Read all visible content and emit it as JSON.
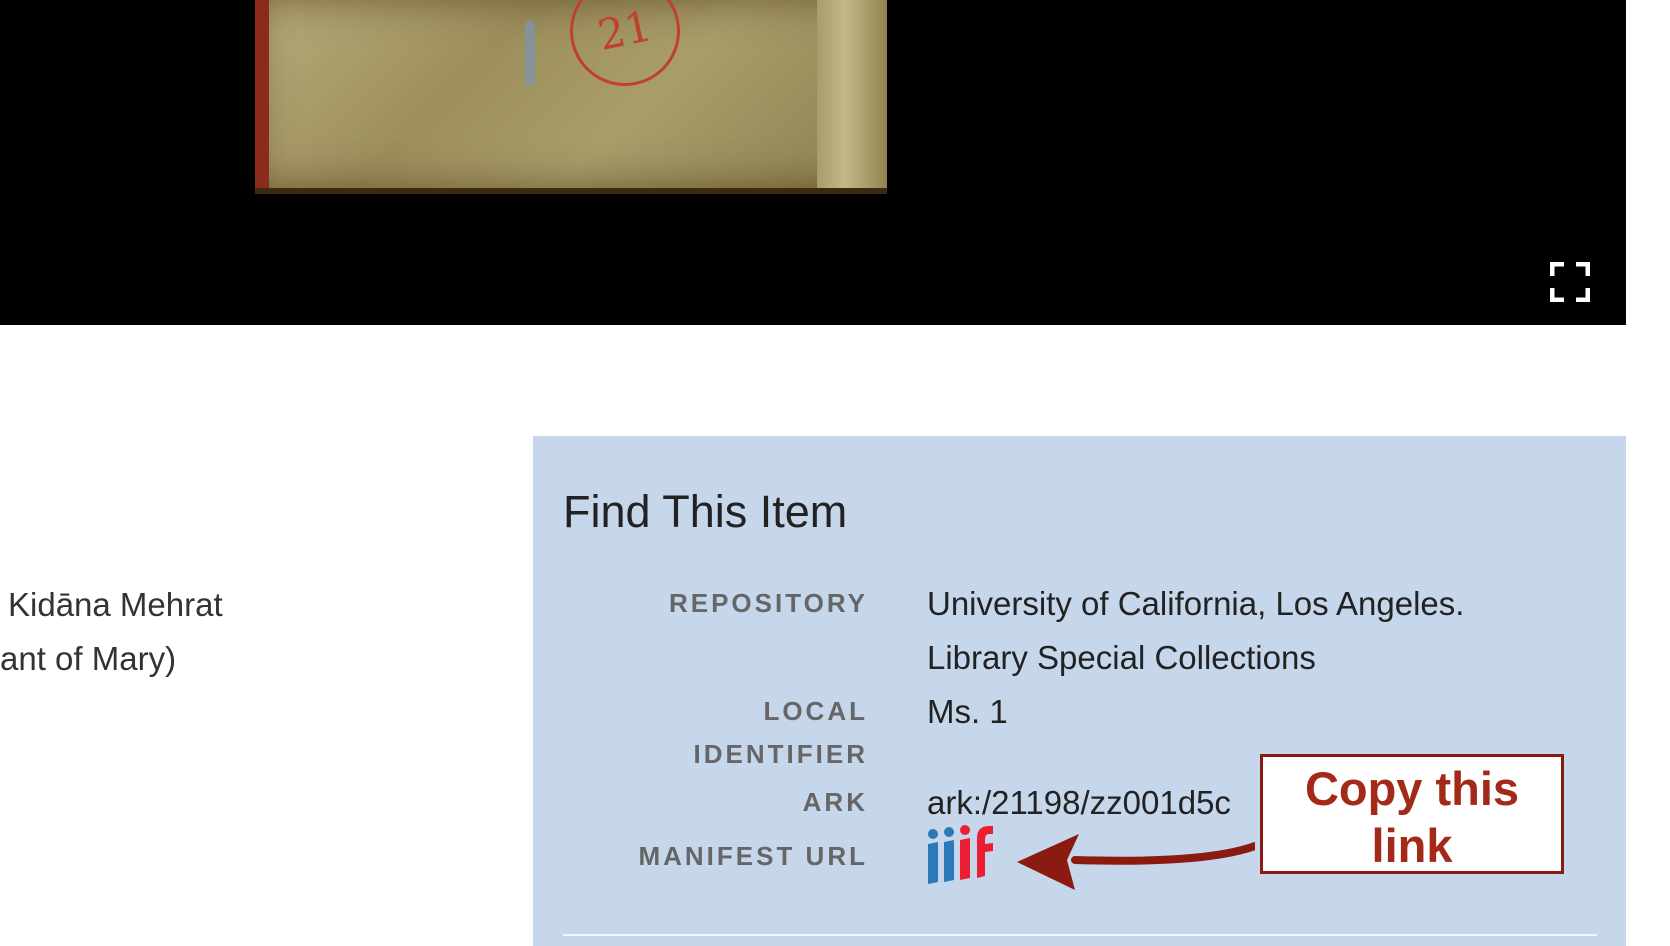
{
  "left_column": {
    "line1": "Kidāna Mehrat",
    "line2": "ant of Mary)"
  },
  "find_item": {
    "title": "Find This Item",
    "fields": {
      "repository": {
        "label": "REPOSITORY",
        "value_line1": "University of California, Los Angeles.",
        "value_line2": "Library Special Collections"
      },
      "local_identifier": {
        "label_line1": "LOCAL",
        "label_line2": "IDENTIFIER",
        "value": "Ms. 1"
      },
      "ark": {
        "label": "ARK",
        "value": "ark:/21198/zz001d5c"
      },
      "manifest_url": {
        "label": "MANIFEST URL",
        "icon": "iiif-logo-icon"
      }
    }
  },
  "annotation": {
    "callout_line1": "Copy this",
    "callout_line2": "link",
    "color": "#8b1a10"
  },
  "colors": {
    "panel_bg": "#c6d7ec",
    "viewer_bg": "#000000"
  },
  "viewer": {
    "item_number": "21"
  }
}
